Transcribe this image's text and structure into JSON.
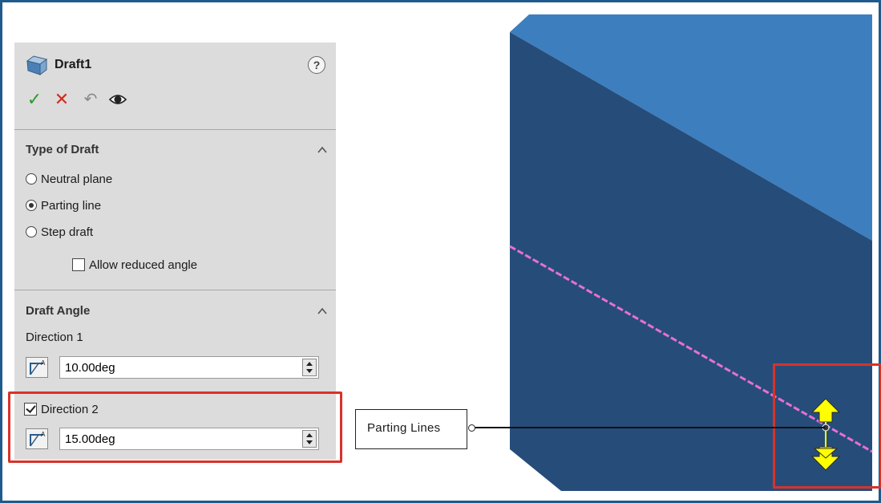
{
  "feature": {
    "title": "Draft1",
    "help_symbol": "?"
  },
  "actions": {
    "ok_symbol": "✓",
    "cancel_symbol": "✕",
    "undo_symbol": "↶"
  },
  "type_of_draft": {
    "title": "Type of Draft",
    "options": [
      {
        "label": "Neutral plane",
        "selected": false
      },
      {
        "label": "Parting line",
        "selected": true
      },
      {
        "label": "Step draft",
        "selected": false
      }
    ],
    "allow_reduced_angle": {
      "label": "Allow reduced angle",
      "checked": false
    }
  },
  "draft_angle": {
    "title": "Draft Angle",
    "direction1": {
      "label": "Direction 1",
      "value": "10.00deg"
    },
    "direction2": {
      "label": "Direction 2",
      "checked": true,
      "value": "15.00deg"
    }
  },
  "callout": {
    "label": "Parting Lines"
  },
  "colors": {
    "model_top": "#3d7ebf",
    "model_front": "#264d7a",
    "parting_line": "#e86fd6",
    "arrow": "#ffff00",
    "highlight": "#d8322a"
  }
}
